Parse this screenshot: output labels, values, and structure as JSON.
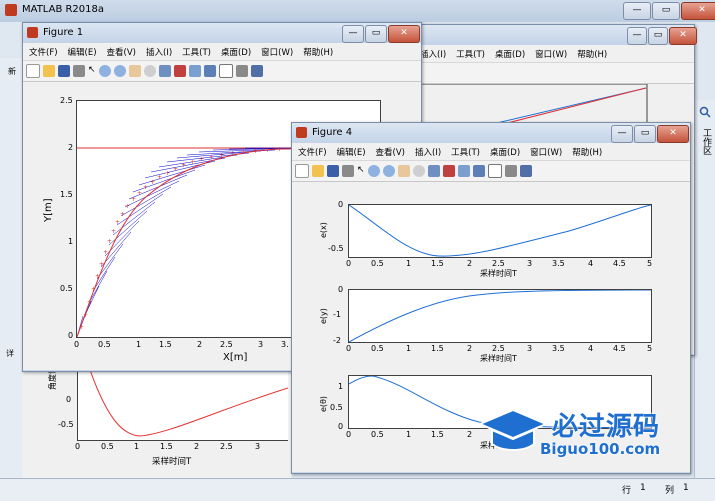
{
  "main": {
    "title": "MATLAB R2018a",
    "status_row_label": "行",
    "status_row_value": "1",
    "status_col_label": "列",
    "status_col_value": "1",
    "side_label": "工作区",
    "side_left_label": "详",
    "new_label": "新"
  },
  "figure1": {
    "title": "Figure 1",
    "menus": [
      "文件(F)",
      "编辑(E)",
      "查看(V)",
      "插入(I)",
      "工具(T)",
      "桌面(D)",
      "窗口(W)",
      "帮助(H)"
    ],
    "xlabel": "X[m]",
    "ylabel": "Y[m]",
    "xticks": [
      "0",
      "0.5",
      "1",
      "1.5",
      "2",
      "2.5",
      "3",
      "3."
    ],
    "yticks": [
      "0",
      "0.5",
      "1",
      "1.5",
      "2",
      "2.5"
    ]
  },
  "figure4": {
    "title": "Figure 4",
    "menus": [
      "文件(F)",
      "编辑(E)",
      "查看(V)",
      "插入(I)",
      "工具(T)",
      "桌面(D)",
      "窗口(W)",
      "帮助(H)"
    ],
    "xticks": [
      "0",
      "0.5",
      "1",
      "1.5",
      "2",
      "2.5",
      "3",
      "3.5",
      "4",
      "4.5",
      "5"
    ],
    "sub1": {
      "ylabel": "e(x)",
      "yticks": [
        "0",
        "-0.5"
      ],
      "xlabel": "采样时间T"
    },
    "sub2": {
      "ylabel": "e(y)",
      "yticks": [
        "0",
        "-1",
        "-2"
      ],
      "xlabel": "采样时间T"
    },
    "sub3": {
      "ylabel": "e(θ)",
      "yticks": [
        "1",
        "0.5",
        "0"
      ],
      "xlabel": "采样时间T"
    }
  },
  "background_plot": {
    "ylabel": "角度误",
    "yticks": [
      "0",
      "-0.5"
    ],
    "xticks": [
      "0",
      "0.5",
      "1",
      "1.5",
      "2",
      "2.5",
      "3"
    ],
    "xlabel": "采样时间T"
  },
  "watermark": {
    "brand": "必过源码",
    "url": "Biguo100.com"
  },
  "colors": {
    "accent": "#c03a20",
    "series_blue": "#1f6fd6",
    "series_red": "#e23030",
    "fig_blue": "#0000cc"
  }
}
